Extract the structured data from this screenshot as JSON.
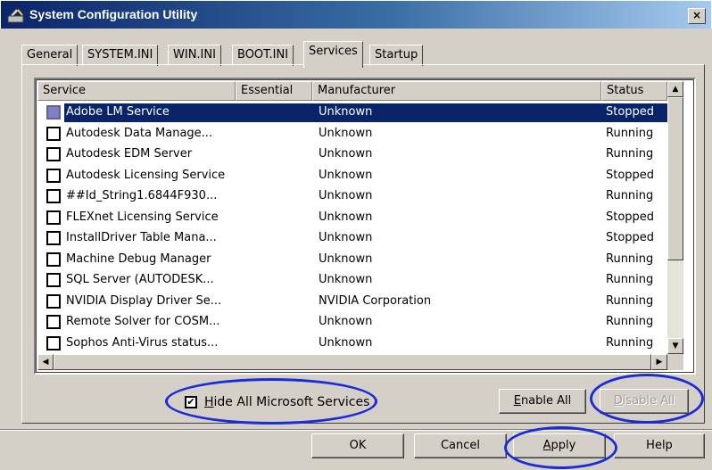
{
  "window": {
    "title": "System Configuration Utility",
    "close_glyph": "×"
  },
  "tabs": [
    {
      "label": "General"
    },
    {
      "label": "SYSTEM.INI"
    },
    {
      "label": "WIN.INI"
    },
    {
      "label": "BOOT.INI"
    },
    {
      "label": "Services",
      "active": true
    },
    {
      "label": "Startup"
    }
  ],
  "columns": {
    "service": "Service",
    "essential": "Essential",
    "manufacturer": "Manufacturer",
    "status": "Status"
  },
  "services": [
    {
      "name": "Adobe LM Service",
      "essential": "",
      "manufacturer": "Unknown",
      "status": "Stopped",
      "checked": false,
      "selected": true
    },
    {
      "name": "Autodesk Data Manage...",
      "essential": "",
      "manufacturer": "Unknown",
      "status": "Running",
      "checked": false
    },
    {
      "name": "Autodesk EDM Server",
      "essential": "",
      "manufacturer": "Unknown",
      "status": "Running",
      "checked": false
    },
    {
      "name": "Autodesk Licensing Service",
      "essential": "",
      "manufacturer": "Unknown",
      "status": "Stopped",
      "checked": false
    },
    {
      "name": "##Id_String1.6844F930...",
      "essential": "",
      "manufacturer": "Unknown",
      "status": "Running",
      "checked": false
    },
    {
      "name": "FLEXnet Licensing Service",
      "essential": "",
      "manufacturer": "Unknown",
      "status": "Stopped",
      "checked": false
    },
    {
      "name": "InstallDriver Table Mana...",
      "essential": "",
      "manufacturer": "Unknown",
      "status": "Stopped",
      "checked": false
    },
    {
      "name": "Machine Debug Manager",
      "essential": "",
      "manufacturer": "Unknown",
      "status": "Running",
      "checked": false
    },
    {
      "name": "SQL Server (AUTODESK...",
      "essential": "",
      "manufacturer": "Unknown",
      "status": "Running",
      "checked": false
    },
    {
      "name": "NVIDIA Display Driver Se...",
      "essential": "",
      "manufacturer": "NVIDIA Corporation",
      "status": "Running",
      "checked": false
    },
    {
      "name": "Remote Solver for COSM...",
      "essential": "",
      "manufacturer": "Unknown",
      "status": "Running",
      "checked": false
    },
    {
      "name": "Sophos Anti-Virus status...",
      "essential": "",
      "manufacturer": "Unknown",
      "status": "Running",
      "checked": false
    }
  ],
  "options": {
    "hide_microsoft": {
      "prefix": "H",
      "rest": "ide All Microsoft Services",
      "checked": true,
      "check_glyph": "✔"
    }
  },
  "buttons": {
    "enable_all": {
      "prefix": "E",
      "rest": "nable All"
    },
    "disable_all": {
      "prefix": "D",
      "rest": "isable All",
      "disabled": true
    },
    "ok": "OK",
    "cancel": "Cancel",
    "apply": {
      "prefix": "A",
      "rest": "pply"
    },
    "help": "Help"
  },
  "highlight_color": "#1c2bd8"
}
